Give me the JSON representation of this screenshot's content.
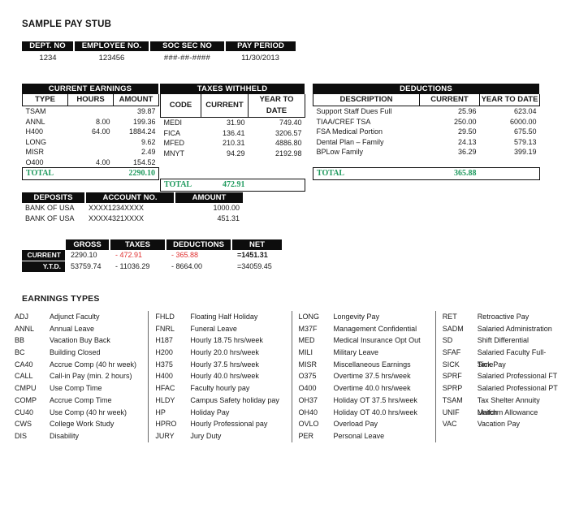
{
  "page_title": "SAMPLE PAY STUB",
  "employee": {
    "columns": [
      "DEPT. NO",
      "EMPLOYEE NO.",
      "SOC SEC NO",
      "PAY PERIOD"
    ],
    "values": [
      "1234",
      "123456",
      "###-##-####",
      "11/30/2013"
    ]
  },
  "current_earnings": {
    "band": "CURRENT EARNINGS",
    "columns": [
      "TYPE",
      "HOURS",
      "AMOUNT"
    ],
    "rows": [
      {
        "type": "TSAM",
        "hours": "",
        "amount": "39.87"
      },
      {
        "type": "ANNL",
        "hours": "8.00",
        "amount": "199.36"
      },
      {
        "type": "H400",
        "hours": "64.00",
        "amount": "1884.24"
      },
      {
        "type": "LONG",
        "hours": "",
        "amount": "9.62"
      },
      {
        "type": "MISR",
        "hours": "",
        "amount": "2.49"
      },
      {
        "type": "O400",
        "hours": "4.00",
        "amount": "154.52"
      }
    ],
    "total_label": "TOTAL",
    "total_amount": "2290.10"
  },
  "taxes_withheld": {
    "band": "TAXES WITHHELD",
    "columns": [
      "CODE",
      "CURRENT",
      "YEAR TO DATE"
    ],
    "rows": [
      {
        "code": "MEDI",
        "current": "31.90",
        "ytd": "749.40"
      },
      {
        "code": "FICA",
        "current": "136.41",
        "ytd": "3206.57"
      },
      {
        "code": "MFED",
        "current": "210.31",
        "ytd": "4886.80"
      },
      {
        "code": "MNYT",
        "current": "94.29",
        "ytd": "2192.98"
      },
      {
        "code": "",
        "current": "",
        "ytd": ""
      },
      {
        "code": "",
        "current": "",
        "ytd": ""
      }
    ],
    "total_label": "TOTAL",
    "total_current": "472.91"
  },
  "deductions": {
    "band": "DEDUCTIONS",
    "columns": [
      "DESCRIPTION",
      "CURRENT",
      "YEAR TO DATE"
    ],
    "rows": [
      {
        "description": "Support Staff Dues Full",
        "current": "25.96",
        "ytd": "623.04"
      },
      {
        "description": "TIAA/CREF TSA",
        "current": "250.00",
        "ytd": "6000.00"
      },
      {
        "description": "FSA Medical Portion",
        "current": "29.50",
        "ytd": "675.50"
      },
      {
        "description": "Dental Plan – Family",
        "current": "24.13",
        "ytd": "579.13"
      },
      {
        "description": "BPLow Family",
        "current": "36.29",
        "ytd": "399.19"
      },
      {
        "description": "",
        "current": "",
        "ytd": ""
      }
    ],
    "total_label": "TOTAL",
    "total_current": "365.88"
  },
  "deposits": {
    "columns": [
      "DEPOSITS",
      "ACCOUNT NO.",
      "AMOUNT"
    ],
    "rows": [
      {
        "bank": "BANK OF USA",
        "account": "XXXX1234XXXX",
        "amount": "1000.00"
      },
      {
        "bank": "BANK OF USA",
        "account": "XXXX4321XXXX",
        "amount": "451.31"
      }
    ]
  },
  "summary": {
    "columns": [
      "GROSS",
      "TAXES",
      "DEDUCTIONS",
      "NET"
    ],
    "rows": [
      {
        "label": "CURRENT",
        "gross": "2290.10",
        "taxes": "- 472.91",
        "deductions": "- 365.88",
        "net": "=1451.31"
      },
      {
        "label": "Y.T.D.",
        "gross": "53759.74",
        "taxes": "- 11036.29",
        "deductions": "- 8664.00",
        "net": "=34059.45"
      }
    ]
  },
  "legend": {
    "title": "EARNINGS TYPES",
    "columns": [
      [
        {
          "code": "ADJ",
          "desc": "Adjunct Faculty"
        },
        {
          "code": "ANNL",
          "desc": "Annual Leave"
        },
        {
          "code": "BB",
          "desc": "Vacation Buy Back"
        },
        {
          "code": "BC",
          "desc": "Building Closed"
        },
        {
          "code": "CA40",
          "desc": "Accrue Comp (40 hr week)"
        },
        {
          "code": "CALL",
          "desc": "Call-in Pay (min. 2 hours)"
        },
        {
          "code": "CMPU",
          "desc": "Use Comp Time"
        },
        {
          "code": "COMP",
          "desc": "Accrue Comp Time"
        },
        {
          "code": "CU40",
          "desc": "Use Comp (40 hr week)"
        },
        {
          "code": "CWS",
          "desc": "College Work Study"
        },
        {
          "code": "DIS",
          "desc": "Disability"
        }
      ],
      [
        {
          "code": "FHLD",
          "desc": "Floating Half Holiday"
        },
        {
          "code": "FNRL",
          "desc": "Funeral Leave"
        },
        {
          "code": "H187",
          "desc": "Hourly 18.75 hrs/week"
        },
        {
          "code": "H200",
          "desc": "Hourly 20.0 hrs/week"
        },
        {
          "code": "H375",
          "desc": "Hourly 37.5 hrs/week"
        },
        {
          "code": "H400",
          "desc": "Hourly 40.0 hrs/week"
        },
        {
          "code": "HFAC",
          "desc": "Faculty hourly pay"
        },
        {
          "code": "HLDY",
          "desc": "Campus Safety holiday pay"
        },
        {
          "code": "HP",
          "desc": "Holiday Pay"
        },
        {
          "code": "HPRO",
          "desc": "Hourly Professional pay"
        },
        {
          "code": "JURY",
          "desc": "Jury Duty"
        }
      ],
      [
        {
          "code": "LONG",
          "desc": "Longevity Pay"
        },
        {
          "code": "M37F",
          "desc": "Management Confidential"
        },
        {
          "code": "MED",
          "desc": "Medical Insurance Opt Out"
        },
        {
          "code": "MILI",
          "desc": "Military Leave"
        },
        {
          "code": "MISR",
          "desc": "Miscellaneous Earnings"
        },
        {
          "code": "O375",
          "desc": "Overtime 37.5 hrs/week"
        },
        {
          "code": "O400",
          "desc": "Overtime 40.0 hrs/week"
        },
        {
          "code": "OH37",
          "desc": "Holiday OT 37.5 hrs/week"
        },
        {
          "code": "OH40",
          "desc": "Holiday OT 40.0 hrs/week"
        },
        {
          "code": "OVLO",
          "desc": "Overload Pay"
        },
        {
          "code": "PER",
          "desc": "Personal Leave"
        }
      ],
      [
        {
          "code": "RET",
          "desc": "Retroactive Pay"
        },
        {
          "code": "SADM",
          "desc": "Salaried Administration"
        },
        {
          "code": "SD",
          "desc": "Shift Differential"
        },
        {
          "code": "SFAF",
          "desc": "Salaried Faculty Full-Time"
        },
        {
          "code": "SICK",
          "desc": "Sick Pay"
        },
        {
          "code": "SPRF",
          "desc": "Salaried Professional FT"
        },
        {
          "code": "SPRP",
          "desc": "Salaried Professional PT"
        },
        {
          "code": "TSAM",
          "desc": "Tax Shelter Annuity Match"
        },
        {
          "code": "UNIF",
          "desc": "Uniform Allowance"
        },
        {
          "code": "VAC",
          "desc": "Vacation Pay"
        }
      ]
    ]
  }
}
